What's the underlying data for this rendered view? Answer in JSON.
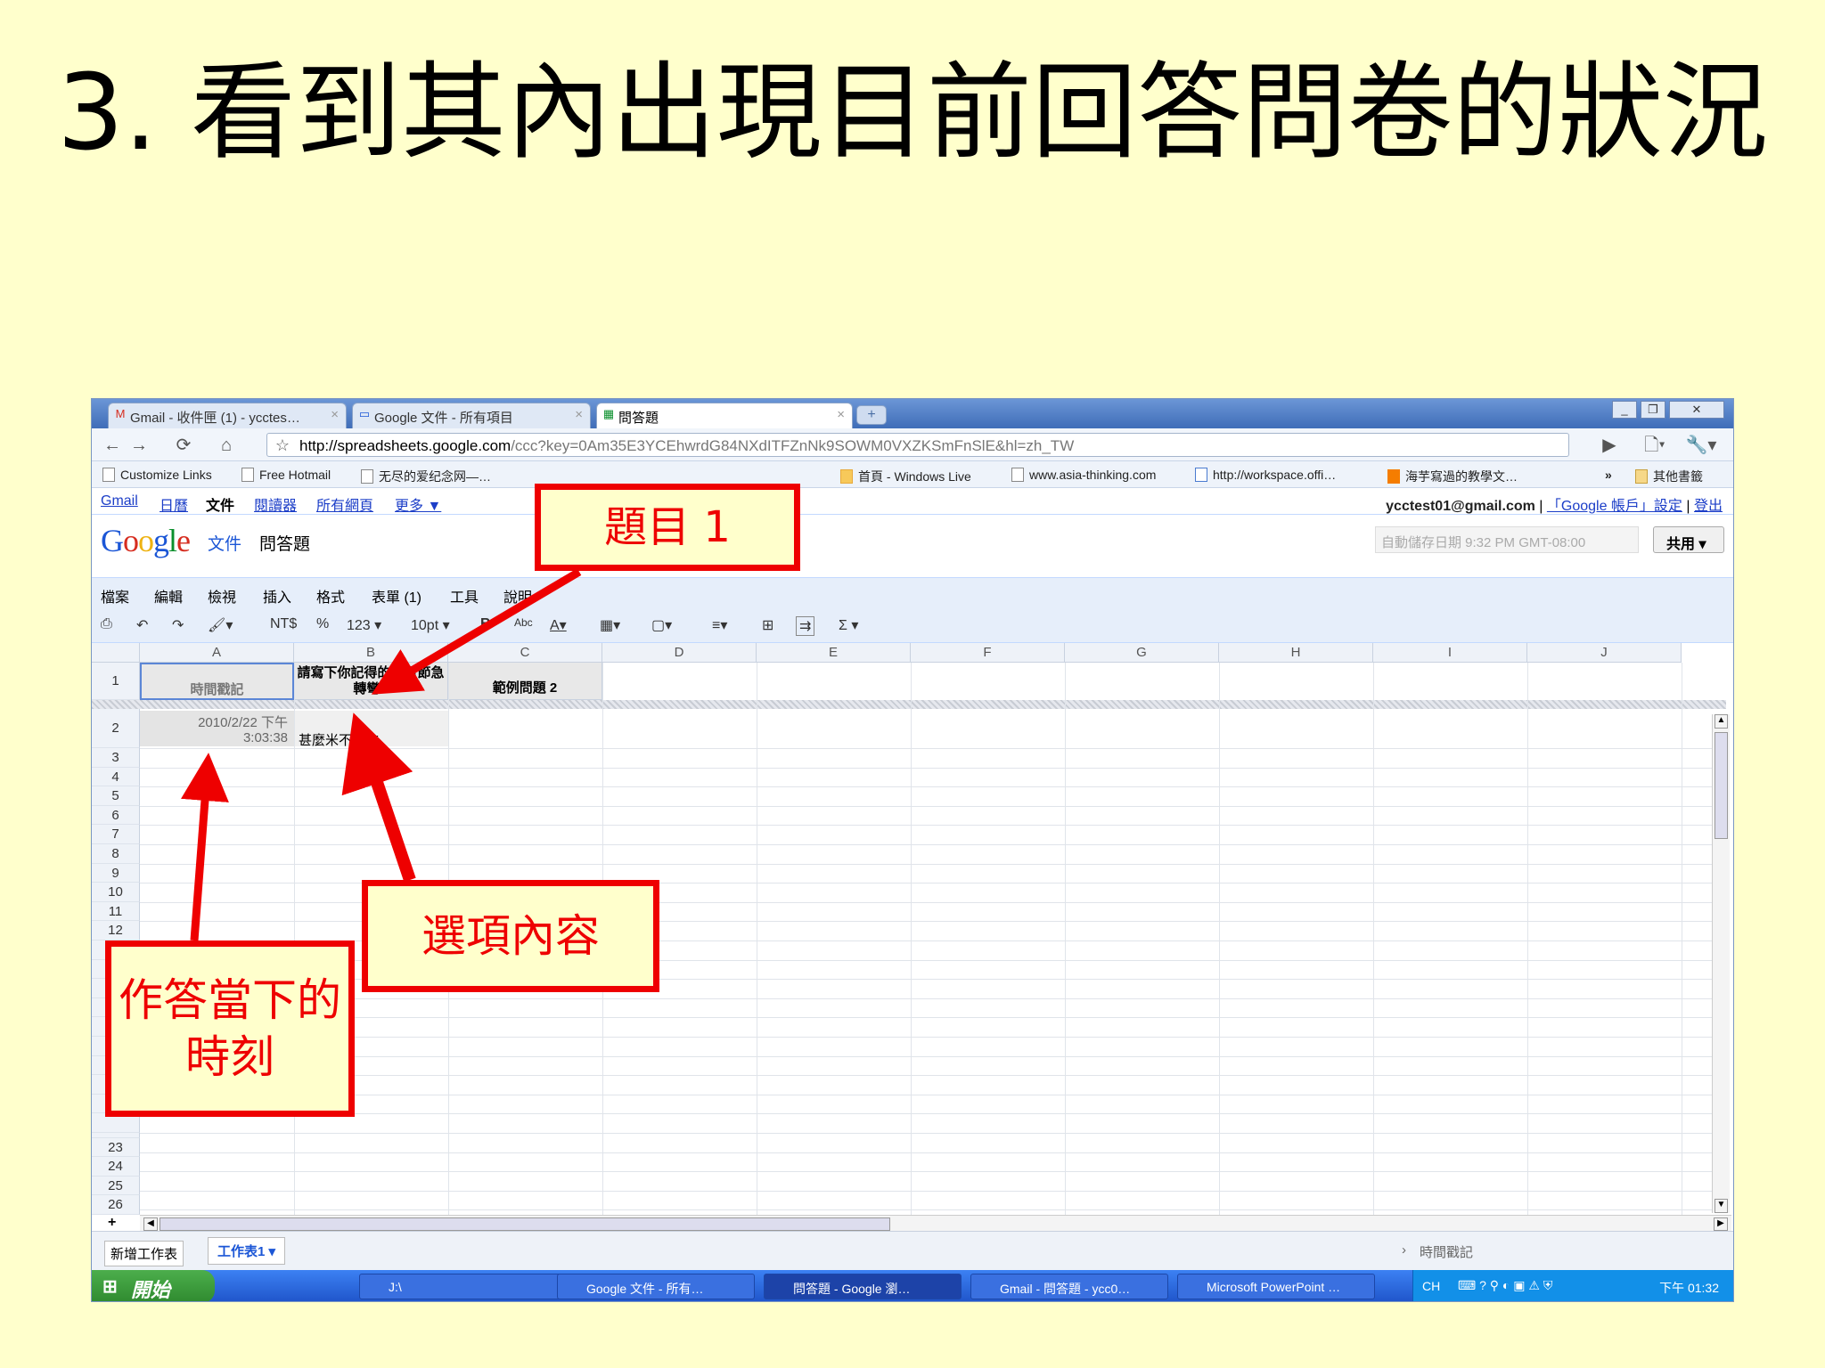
{
  "slide": {
    "title": "3. 看到其內出現目前回答問卷的狀況"
  },
  "browser": {
    "tabs": [
      {
        "icon": "gmail-icon",
        "label": "Gmail - 收件匣 (1) - ycctes…"
      },
      {
        "icon": "docs-icon",
        "label": "Google 文件 - 所有項目"
      },
      {
        "icon": "spreadsheet-icon",
        "label": "問答題"
      }
    ],
    "url_host": "http://spreadsheets.google.com",
    "url_rest": "/ccc?key=0Am35E3YCEhwrdG84NXdITFZnNk9SOWM0VXZKSmFnSlE&hl=zh_TW",
    "bookmarks": [
      "Customize Links",
      "Free Hotmail",
      "无尽的爱纪念网—…",
      "首頁 - Windows Live",
      "www.asia-thinking.com",
      "http://workspace.offi…",
      "海芋寫過的教學文…"
    ],
    "other_bookmarks": "其他書籤"
  },
  "google_bar": {
    "links": [
      "Gmail",
      "日曆",
      "文件",
      "閱讀器",
      "所有網頁",
      "更多 ▼"
    ],
    "current": "文件",
    "account": "ycctest01@gmail.com",
    "account_links": [
      "「Google 帳戶」設定",
      "登出"
    ]
  },
  "doc": {
    "logo_label": "文件",
    "title": "問答題",
    "autosave": "自動儲存日期 9:32 PM GMT-08:00",
    "share": "共用 ▾"
  },
  "menu": [
    "檔案",
    "編輯",
    "檢視",
    "插入",
    "格式",
    "表單 (1)",
    "工具",
    "說明"
  ],
  "toolbar": {
    "currency": "NT$",
    "percent": "%",
    "number": "123 ▾",
    "fontsize": "10pt ▾",
    "sigma": "Σ ▾"
  },
  "sheet": {
    "columns": [
      "A",
      "B",
      "C",
      "D",
      "E",
      "F",
      "G",
      "H",
      "I",
      "J"
    ],
    "header_row": [
      "時間戳記",
      "請寫下你記得的題目節急轉彎?",
      "範例問題 2"
    ],
    "rows": [
      {
        "num": "2",
        "a_line1": "2010/2/22 下午",
        "a_line2": "3:03:38",
        "b": "甚麼米不能吃"
      }
    ],
    "row_numbers": [
      "1",
      "2",
      "3",
      "4",
      "5",
      "6",
      "7",
      "8",
      "9",
      "10",
      "11",
      "12",
      "22",
      "23",
      "24",
      "25",
      "26"
    ],
    "add_sheet": "新增工作表",
    "sheet_tab": "工作表1 ▾",
    "status": "時間戳記",
    "add_row": "+"
  },
  "taskbar": {
    "start": "開始",
    "tasks": [
      "J:\\",
      "Google 文件 - 所有…",
      "問答題 - Google 瀏…",
      "Gmail - 問答題 - ycc0…",
      "Microsoft PowerPoint …"
    ],
    "lang": "CH",
    "time": "下午 01:32"
  },
  "callouts": {
    "question": "題目 1",
    "options": "選項內容",
    "timestamp_line1": "作答當下的",
    "timestamp_line2": "時刻"
  },
  "colors": {
    "callout_red": "#ee0000",
    "slide_bg": "#ffffcc"
  }
}
